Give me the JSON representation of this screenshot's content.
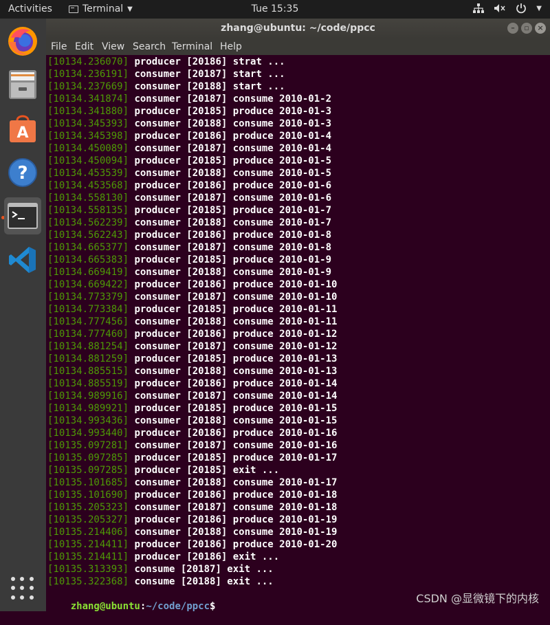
{
  "topbar": {
    "activities": "Activities",
    "app_name": "Terminal",
    "clock": "Tue 15:35"
  },
  "window": {
    "title": "zhang@ubuntu: ~/code/ppcc"
  },
  "menu": [
    "File",
    "Edit",
    "View",
    "Search",
    "Terminal",
    "Help"
  ],
  "dock": [
    {
      "name": "firefox-icon"
    },
    {
      "name": "files-icon"
    },
    {
      "name": "software-center-icon"
    },
    {
      "name": "help-icon"
    },
    {
      "name": "terminal-icon",
      "active": true
    },
    {
      "name": "vscode-icon"
    }
  ],
  "terminal": {
    "lines": [
      {
        "ts": "[10134.236070]",
        "text": " producer [20186] strat ..."
      },
      {
        "ts": "[10134.236191]",
        "text": " consumer [20187] start ..."
      },
      {
        "ts": "[10134.237669]",
        "text": " consumer [20188] start ..."
      },
      {
        "ts": "[10134.341874]",
        "text": " consumer [20187] consume 2010-01-2"
      },
      {
        "ts": "[10134.341880]",
        "text": " producer [20185] produce 2010-01-3"
      },
      {
        "ts": "[10134.345393]",
        "text": " consumer [20188] consume 2010-01-3"
      },
      {
        "ts": "[10134.345398]",
        "text": " producer [20186] produce 2010-01-4"
      },
      {
        "ts": "[10134.450089]",
        "text": " consumer [20187] consume 2010-01-4"
      },
      {
        "ts": "[10134.450094]",
        "text": " producer [20185] produce 2010-01-5"
      },
      {
        "ts": "[10134.453539]",
        "text": " consumer [20188] consume 2010-01-5"
      },
      {
        "ts": "[10134.453568]",
        "text": " producer [20186] produce 2010-01-6"
      },
      {
        "ts": "[10134.558130]",
        "text": " consumer [20187] consume 2010-01-6"
      },
      {
        "ts": "[10134.558135]",
        "text": " producer [20185] produce 2010-01-7"
      },
      {
        "ts": "[10134.562239]",
        "text": " consumer [20188] consume 2010-01-7"
      },
      {
        "ts": "[10134.562243]",
        "text": " producer [20186] produce 2010-01-8"
      },
      {
        "ts": "[10134.665377]",
        "text": " consumer [20187] consume 2010-01-8"
      },
      {
        "ts": "[10134.665383]",
        "text": " producer [20185] produce 2010-01-9"
      },
      {
        "ts": "[10134.669419]",
        "text": " consumer [20188] consume 2010-01-9"
      },
      {
        "ts": "[10134.669422]",
        "text": " producer [20186] produce 2010-01-10"
      },
      {
        "ts": "[10134.773379]",
        "text": " consumer [20187] consume 2010-01-10"
      },
      {
        "ts": "[10134.773384]",
        "text": " producer [20185] produce 2010-01-11"
      },
      {
        "ts": "[10134.777456]",
        "text": " consumer [20188] consume 2010-01-11"
      },
      {
        "ts": "[10134.777460]",
        "text": " producer [20186] produce 2010-01-12"
      },
      {
        "ts": "[10134.881254]",
        "text": " consumer [20187] consume 2010-01-12"
      },
      {
        "ts": "[10134.881259]",
        "text": " producer [20185] produce 2010-01-13"
      },
      {
        "ts": "[10134.885515]",
        "text": " consumer [20188] consume 2010-01-13"
      },
      {
        "ts": "[10134.885519]",
        "text": " producer [20186] produce 2010-01-14"
      },
      {
        "ts": "[10134.989916]",
        "text": " consumer [20187] consume 2010-01-14"
      },
      {
        "ts": "[10134.989921]",
        "text": " producer [20185] produce 2010-01-15"
      },
      {
        "ts": "[10134.993436]",
        "text": " consumer [20188] consume 2010-01-15"
      },
      {
        "ts": "[10134.993440]",
        "text": " producer [20186] produce 2010-01-16"
      },
      {
        "ts": "[10135.097281]",
        "text": " consumer [20187] consume 2010-01-16"
      },
      {
        "ts": "[10135.097285]",
        "text": " producer [20185] produce 2010-01-17"
      },
      {
        "ts": "[10135.097285]",
        "text": " producer [20185] exit ..."
      },
      {
        "ts": "[10135.101685]",
        "text": " consumer [20188] consume 2010-01-17"
      },
      {
        "ts": "[10135.101690]",
        "text": " producer [20186] produce 2010-01-18"
      },
      {
        "ts": "[10135.205323]",
        "text": " consumer [20187] consume 2010-01-18"
      },
      {
        "ts": "[10135.205327]",
        "text": " producer [20186] produce 2010-01-19"
      },
      {
        "ts": "[10135.214406]",
        "text": " consumer [20188] consume 2010-01-19"
      },
      {
        "ts": "[10135.214411]",
        "text": " producer [20186] produce 2010-01-20"
      },
      {
        "ts": "[10135.214411]",
        "text": " producer [20186] exit ..."
      },
      {
        "ts": "[10135.313393]",
        "text": " consume [20187] exit ..."
      },
      {
        "ts": "[10135.322368]",
        "text": " consume [20188] exit ..."
      }
    ],
    "prompt": {
      "user_host": "zhang@ubuntu",
      "sep": ":",
      "path": "~/code/ppcc",
      "symbol": "$"
    }
  },
  "watermark": "CSDN @显微镜下的内核",
  "colors": {
    "terminal_bg": "#2c001e",
    "timestamp": "#4e9a06",
    "prompt_user": "#8ae234",
    "prompt_path": "#729fcf",
    "accent": "#e95420"
  }
}
